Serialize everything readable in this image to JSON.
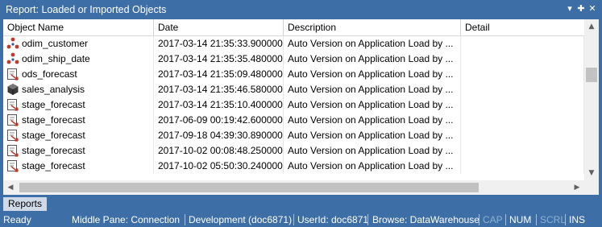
{
  "window": {
    "title": "Report: Loaded or Imported Objects"
  },
  "columns": [
    "Object Name",
    "Date",
    "Description",
    "Detail"
  ],
  "rows": [
    {
      "icon": "dots-icon",
      "name": "odim_customer",
      "date": "2017-03-14 21:35:33.900000",
      "desc": "Auto Version on Application Load by ...",
      "detail": ""
    },
    {
      "icon": "dots-icon",
      "name": "odim_ship_date",
      "date": "2017-03-14 21:35:35.480000",
      "desc": "Auto Version on Application Load by ...",
      "detail": ""
    },
    {
      "icon": "report-icon",
      "name": "ods_forecast",
      "date": "2017-03-14 21:35:09.480000",
      "desc": "Auto Version on Application Load by ...",
      "detail": ""
    },
    {
      "icon": "cube-icon",
      "name": "sales_analysis",
      "date": "2017-03-14 21:35:46.580000",
      "desc": "Auto Version on Application Load by ...",
      "detail": ""
    },
    {
      "icon": "report-icon",
      "name": "stage_forecast",
      "date": "2017-03-14 21:35:10.400000",
      "desc": "Auto Version on Application Load by ...",
      "detail": ""
    },
    {
      "icon": "report-icon",
      "name": "stage_forecast",
      "date": "2017-06-09 00:19:42.600000",
      "desc": "Auto Version on Application Load by ...",
      "detail": ""
    },
    {
      "icon": "report-icon",
      "name": "stage_forecast",
      "date": "2017-09-18 04:39:30.890000",
      "desc": "Auto Version on Application Load by ...",
      "detail": ""
    },
    {
      "icon": "report-icon",
      "name": "stage_forecast",
      "date": "2017-10-02 00:08:48.250000",
      "desc": "Auto Version on Application Load by ...",
      "detail": ""
    },
    {
      "icon": "report-icon",
      "name": "stage_forecast",
      "date": "2017-10-02 05:50:30.240000",
      "desc": "Auto Version on Application Load by ...",
      "detail": ""
    }
  ],
  "tabs": {
    "reports": "Reports"
  },
  "status": {
    "ready": "Ready",
    "middle_pane": "Middle Pane: Connection",
    "environment": "Development (doc6871)",
    "userid": "UserId: doc6871",
    "browse": "Browse: DataWarehouse",
    "cap": "CAP",
    "num": "NUM",
    "scrl": "SCRL",
    "ins": "INS"
  },
  "colors": {
    "titlebar": "#3d6fa6",
    "icon_red": "#c0392b",
    "icon_blue": "#2e5d9a"
  }
}
